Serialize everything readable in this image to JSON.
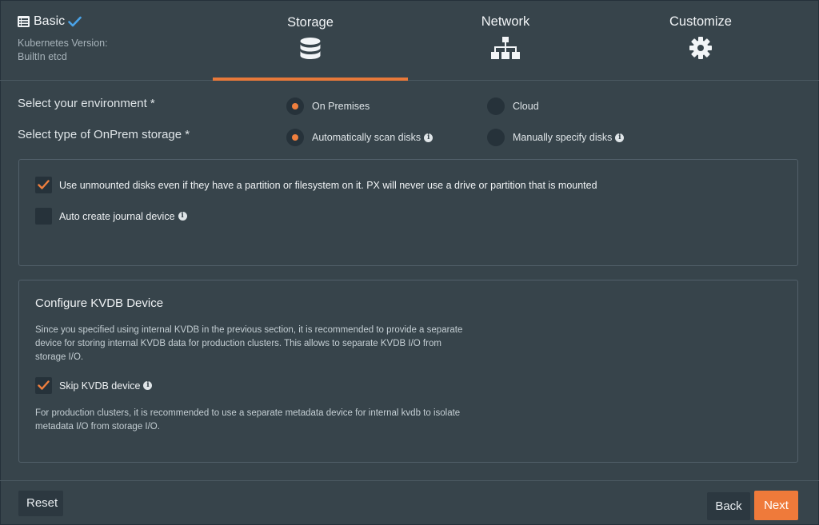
{
  "header": {
    "basic": {
      "title": "Basic",
      "sub_line1": "Kubernetes Version:",
      "sub_line2": "BuiltIn etcd"
    },
    "steps": [
      {
        "label": "Storage",
        "icon": "database-icon",
        "active": true
      },
      {
        "label": "Network",
        "icon": "network-icon",
        "active": false
      },
      {
        "label": "Customize",
        "icon": "gear-icon",
        "active": false
      }
    ]
  },
  "environment": {
    "label": "Select your environment *",
    "options": [
      {
        "label": "On Premises",
        "selected": true
      },
      {
        "label": "Cloud",
        "selected": false
      }
    ]
  },
  "storage_type": {
    "label": "Select type of OnPrem storage *",
    "options": [
      {
        "label": "Automatically scan disks",
        "selected": true
      },
      {
        "label": "Manually specify disks",
        "selected": false
      }
    ]
  },
  "disk_options": {
    "use_unmounted": {
      "label": "Use unmounted disks even if they have a partition or filesystem on it. PX will never use a drive or partition that is mounted",
      "checked": true
    },
    "auto_journal": {
      "label": "Auto create journal device",
      "checked": false
    }
  },
  "kvdb": {
    "title": "Configure KVDB Device",
    "description": "Since you specified using internal KVDB in the previous section, it is recommended to provide a separate device for storing internal KVDB data for production clusters. This allows to separate KVDB I/O from storage I/O.",
    "skip": {
      "label": "Skip KVDB device",
      "checked": true
    },
    "note": "For production clusters, it is recommended to use a separate metadata device for internal kvdb to isolate metadata I/O from storage I/O."
  },
  "footer": {
    "reset_label": "Reset",
    "back_label": "Back",
    "next_label": "Next"
  },
  "colors": {
    "background": "#37444b",
    "accent": "#ef7a3a",
    "control_bg": "#26323a"
  }
}
